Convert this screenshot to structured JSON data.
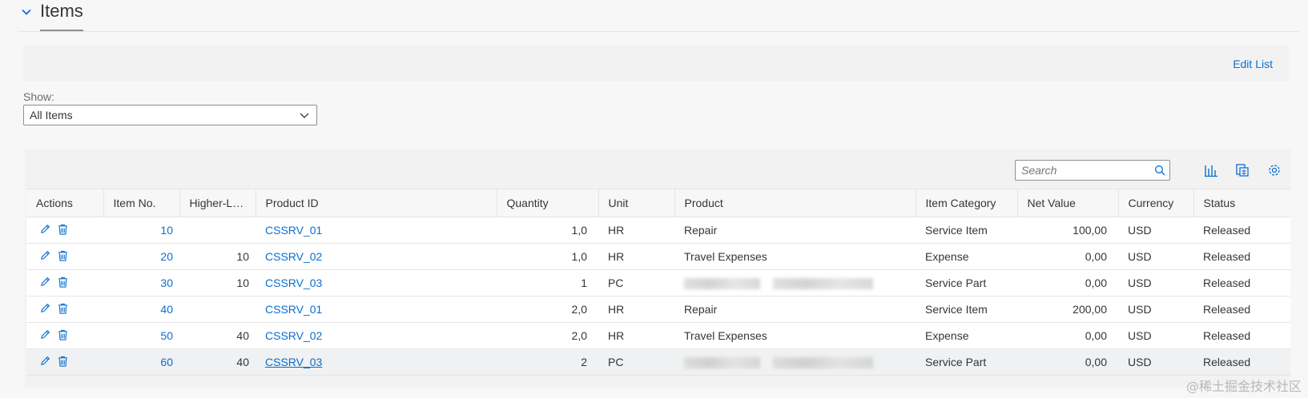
{
  "section": {
    "title": "Items"
  },
  "toolbar": {
    "edit_list": "Edit List"
  },
  "filter": {
    "label": "Show:",
    "value": "All Items"
  },
  "search": {
    "placeholder": "Search"
  },
  "table": {
    "columns": [
      "Actions",
      "Item No.",
      "Higher-Le...",
      "Product ID",
      "Quantity",
      "Unit",
      "Product",
      "Item Category",
      "Net Value",
      "Currency",
      "Status"
    ],
    "rows": [
      {
        "item_no": "10",
        "higher": "",
        "product_id": "CSSRV_01",
        "quantity": "1,0",
        "unit": "HR",
        "product": "Repair",
        "category": "Service Item",
        "net_value": "100,00",
        "currency": "USD",
        "status": "Released"
      },
      {
        "item_no": "20",
        "higher": "10",
        "product_id": "CSSRV_02",
        "quantity": "1,0",
        "unit": "HR",
        "product": "Travel Expenses",
        "category": "Expense",
        "net_value": "0,00",
        "currency": "USD",
        "status": "Released"
      },
      {
        "item_no": "30",
        "higher": "10",
        "product_id": "CSSRV_03",
        "quantity": "1",
        "unit": "PC",
        "product": "",
        "category": "Service Part",
        "net_value": "0,00",
        "currency": "USD",
        "status": "Released"
      },
      {
        "item_no": "40",
        "higher": "",
        "product_id": "CSSRV_01",
        "quantity": "2,0",
        "unit": "HR",
        "product": "Repair",
        "category": "Service Item",
        "net_value": "200,00",
        "currency": "USD",
        "status": "Released"
      },
      {
        "item_no": "50",
        "higher": "40",
        "product_id": "CSSRV_02",
        "quantity": "2,0",
        "unit": "HR",
        "product": "Travel Expenses",
        "category": "Expense",
        "net_value": "0,00",
        "currency": "USD",
        "status": "Released"
      },
      {
        "item_no": "60",
        "higher": "40",
        "product_id": "CSSRV_03",
        "quantity": "2",
        "unit": "PC",
        "product": "",
        "category": "Service Part",
        "net_value": "0,00",
        "currency": "USD",
        "status": "Released"
      }
    ]
  },
  "watermark": "@稀土掘金技术社区",
  "colors": {
    "link": "#0a6ed1",
    "text": "#32363a",
    "background": "#f7f7f7"
  }
}
